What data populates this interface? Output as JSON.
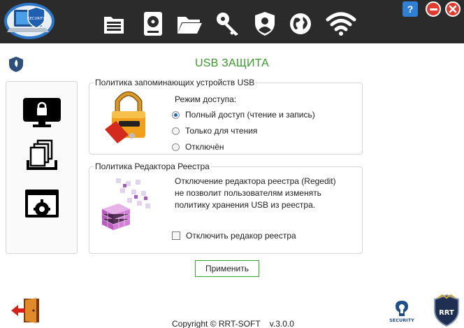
{
  "window": {
    "help_label": "?",
    "help_color": "#2f7fd3",
    "minimize_color": "#e03b2f",
    "close_color": "#e03b2f"
  },
  "toolbar": {
    "logo_text": "SECURITY",
    "items": [
      {
        "name": "file-tool",
        "icon": "document-list-icon"
      },
      {
        "name": "drive-tool",
        "icon": "hard-drive-icon"
      },
      {
        "name": "folder-tool",
        "icon": "folder-icon"
      },
      {
        "name": "key-tool",
        "icon": "key-icon"
      },
      {
        "name": "shield-tool",
        "icon": "shield-user-icon"
      },
      {
        "name": "internet-tool",
        "icon": "globe-icon"
      },
      {
        "name": "wifi-tool",
        "icon": "wifi-icon"
      }
    ]
  },
  "page": {
    "title": "USB ЗАЩИТА",
    "title_color": "#3a9a2e"
  },
  "usb_policy": {
    "legend": "Политика запоминающих устройств USB",
    "mode_label": "Режим доступа:",
    "options": [
      {
        "label": "Полный доступ (чтение и запись)",
        "selected": true
      },
      {
        "label": "Только для чтения",
        "selected": false
      },
      {
        "label": "Отключён",
        "selected": false
      }
    ]
  },
  "registry_policy": {
    "legend": "Политика Редактора Реестра",
    "description_lines": [
      "Отключение редактора реестра (Regedit)",
      "не позволит пользователям изменять",
      "политику хранения USB из реестра."
    ],
    "checkbox_label": "Отключить редакор реестра",
    "checkbox_checked": false
  },
  "actions": {
    "apply_label": "Применить",
    "apply_border_color": "#3aa82c"
  },
  "footer": {
    "copyright": "Copyright © RRT-SOFT",
    "version": "v.3.0.0",
    "security_badge": "SECURITY",
    "rrt_badge": "RRT"
  }
}
